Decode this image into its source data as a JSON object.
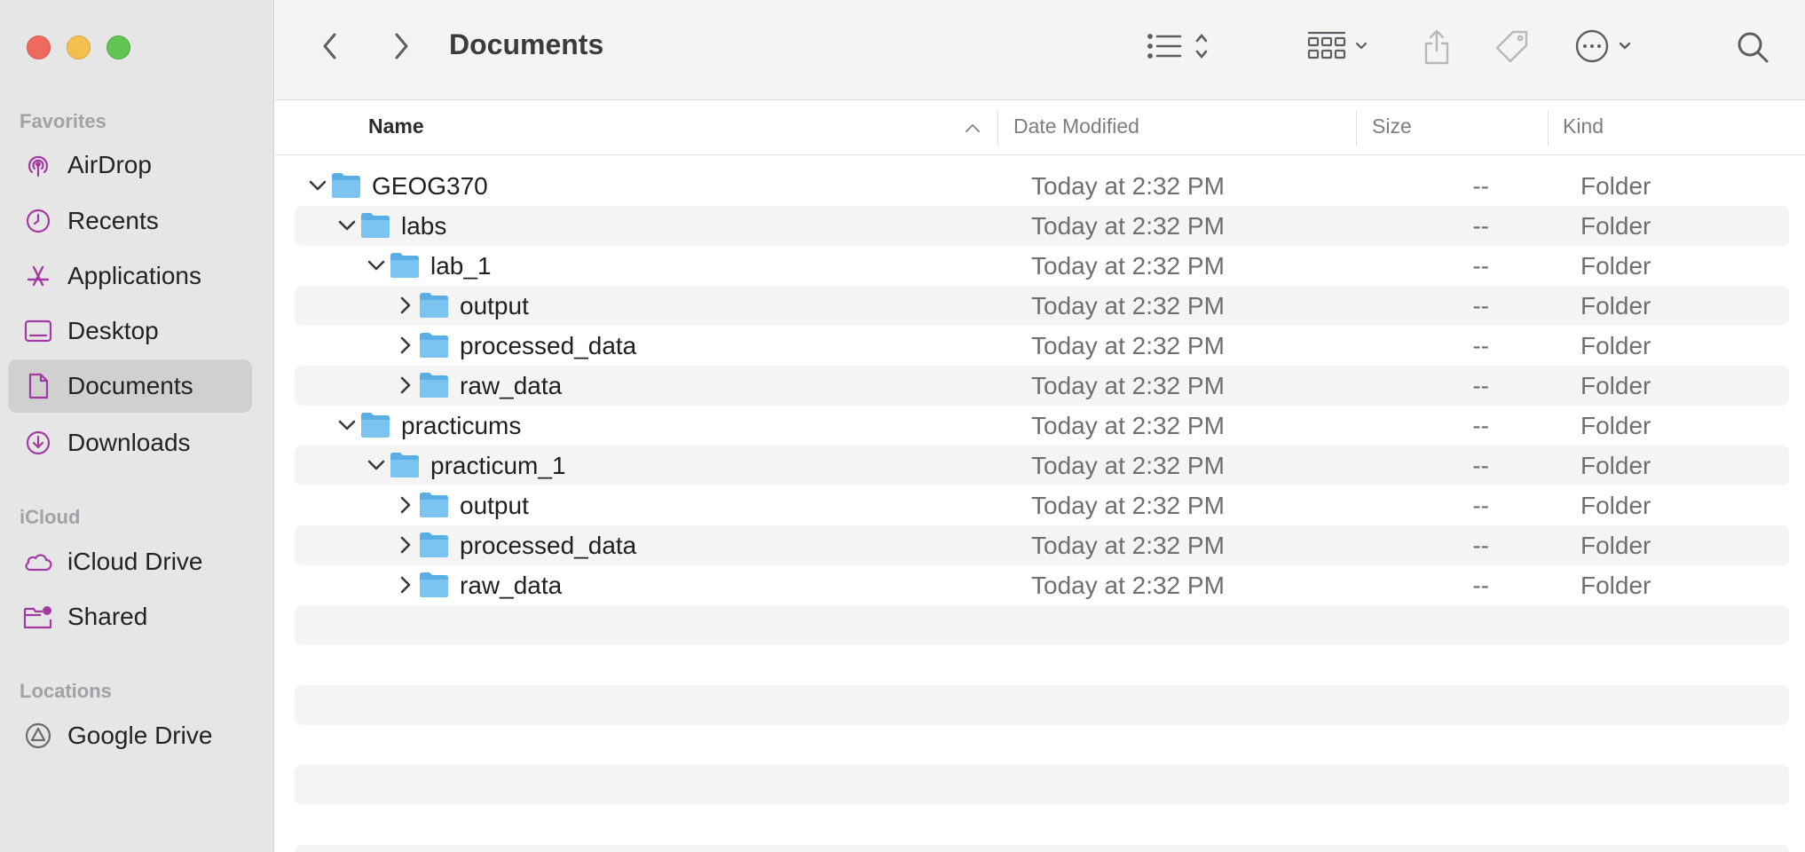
{
  "window": {
    "title": "Documents"
  },
  "sidebar": {
    "sections": [
      {
        "title": "Favorites",
        "items": [
          {
            "label": "AirDrop",
            "icon": "airdrop-icon"
          },
          {
            "label": "Recents",
            "icon": "clock-icon"
          },
          {
            "label": "Applications",
            "icon": "applications-icon"
          },
          {
            "label": "Desktop",
            "icon": "desktop-icon"
          },
          {
            "label": "Documents",
            "icon": "document-icon",
            "selected": true
          },
          {
            "label": "Downloads",
            "icon": "download-icon"
          }
        ]
      },
      {
        "title": "iCloud",
        "items": [
          {
            "label": "iCloud Drive",
            "icon": "cloud-icon"
          },
          {
            "label": "Shared",
            "icon": "shared-folder-icon"
          }
        ]
      },
      {
        "title": "Locations",
        "items": [
          {
            "label": "Google Drive",
            "icon": "google-drive-icon"
          }
        ]
      }
    ]
  },
  "toolbar": {
    "buttons": [
      "back-icon",
      "forward-icon",
      "list-view-icon",
      "group-icon",
      "share-icon",
      "tag-icon",
      "more-actions-icon",
      "search-icon"
    ]
  },
  "columns": {
    "name": "Name",
    "date": "Date Modified",
    "size": "Size",
    "kind": "Kind"
  },
  "rows": [
    {
      "name": "GEOG370",
      "level": 0,
      "expanded": true,
      "date": "Today at 2:32 PM",
      "size": "--",
      "kind": "Folder"
    },
    {
      "name": "labs",
      "level": 1,
      "expanded": true,
      "date": "Today at 2:32 PM",
      "size": "--",
      "kind": "Folder"
    },
    {
      "name": "lab_1",
      "level": 2,
      "expanded": true,
      "date": "Today at 2:32 PM",
      "size": "--",
      "kind": "Folder"
    },
    {
      "name": "output",
      "level": 3,
      "expanded": false,
      "date": "Today at 2:32 PM",
      "size": "--",
      "kind": "Folder"
    },
    {
      "name": "processed_data",
      "level": 3,
      "expanded": false,
      "date": "Today at 2:32 PM",
      "size": "--",
      "kind": "Folder"
    },
    {
      "name": "raw_data",
      "level": 3,
      "expanded": false,
      "date": "Today at 2:32 PM",
      "size": "--",
      "kind": "Folder"
    },
    {
      "name": "practicums",
      "level": 1,
      "expanded": true,
      "date": "Today at 2:32 PM",
      "size": "--",
      "kind": "Folder"
    },
    {
      "name": "practicum_1",
      "level": 2,
      "expanded": true,
      "date": "Today at 2:32 PM",
      "size": "--",
      "kind": "Folder"
    },
    {
      "name": "output",
      "level": 3,
      "expanded": false,
      "date": "Today at 2:32 PM",
      "size": "--",
      "kind": "Folder"
    },
    {
      "name": "processed_data",
      "level": 3,
      "expanded": false,
      "date": "Today at 2:32 PM",
      "size": "--",
      "kind": "Folder"
    },
    {
      "name": "raw_data",
      "level": 3,
      "expanded": false,
      "date": "Today at 2:32 PM",
      "size": "--",
      "kind": "Folder"
    }
  ],
  "colors": {
    "accent": "#a33aa3",
    "folder": "#6cb8ec",
    "selection": "#d0d0d0"
  }
}
